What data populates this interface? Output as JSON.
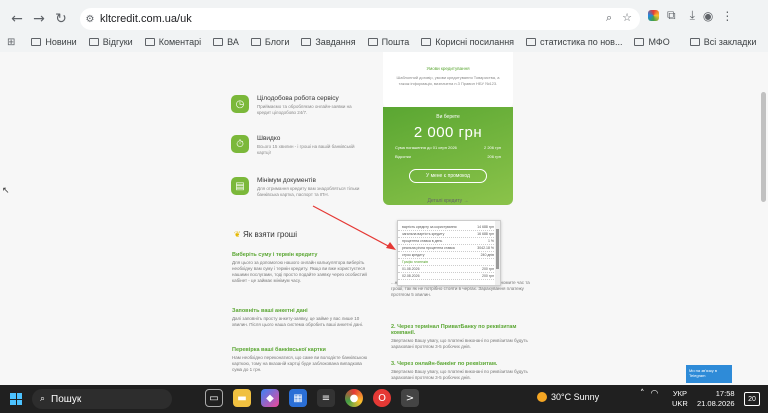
{
  "browser": {
    "url": "kltcredit.com.ua/uk",
    "bookmarks": [
      "Новини",
      "Відгуки",
      "Коментарі",
      "ВА",
      "Блоги",
      "Завдання",
      "Пошта",
      "Корисні посилання",
      "статистика по нов...",
      "МФО"
    ],
    "all_bookmarks": "Всі закладки"
  },
  "features": [
    {
      "title": "Цілодобова робота сервісу",
      "text": "Приймаємо та обробляємо онлайн-заявки на кредит цілодобово 24/7.",
      "icon": "clock-24-icon"
    },
    {
      "title": "Швидко",
      "text": "Всього 15 хвилин - і гроші на вашій банківській картці!",
      "icon": "stopwatch-icon"
    },
    {
      "title": "Мінімум документів",
      "text": "Для отримання кредиту вам знадобляться тільки банківська картка, паспорт та ІПН.",
      "icon": "document-icon"
    }
  ],
  "card": {
    "top_link": "Умови кредитування",
    "top_text": "Шаблонний договір, умови кредитування Товариства, а також інформація, визначена п.3 Правил НБУ №123.",
    "label": "Ви берете",
    "amount": "2 000 грн",
    "rows": [
      {
        "k": "Сума погашення до 01 серп 2026",
        "v": "2 206 грн"
      },
      {
        "k": "Відсотки",
        "v": "206 грн"
      }
    ],
    "button": "У мене є промокод",
    "details": "Деталі кредиту →"
  },
  "howto": {
    "title": "Як взяти гроші",
    "left": [
      {
        "h": "Виберіть суму і термін кредиту",
        "t": "Для цього за допомогою нашого онлайн калькулятора виберіть необхідну вам суму і термін кредиту. Якщо ви вже користуєтеся нашими послугами, тоді просто подайте заявку через особистий кабінет - це займає мінімум часу."
      },
      {
        "h": "Заповніть ваші анкетні дані",
        "t": "Далі заповніть просту анкету-заявку, це займе у вас лише 10 хвилин. Після цього наша система обробить ваші анкетні дані."
      },
      {
        "h": "Перевірка ваші банківської картки",
        "t": "Нам необхідно переконатися, що саме ви володієте банківською карткою, тому на вказаній картці буде заблокована випадкова сума до 1 грн."
      }
    ],
    "right": [
      {
        "h": "1. ...",
        "t": "...найзручніший спосіб оплати, завдяки якому ви економите час та гроші, так як не потрібно стояти в чергах. Зарахування платежу протягом 5 хвилин."
      },
      {
        "h": "2. Через термінал ПриватБанку по реквізитам компанії.",
        "t": "Звертаємо Вашу увагу, що платежі виконані по реквізитам будуть зараховані протягом 3-5 робочих днів."
      },
      {
        "h": "3. Через онлайн-банкінг по реквізитам.",
        "t": "Звертаємо Вашу увагу, що платежі виконані по реквізитам будуть зараховані протягом 3-5 робочих днів."
      }
    ]
  },
  "popup_rows": [
    {
      "k": "вартість кредиту за користування",
      "v": "14 688 грн"
    },
    {
      "k": "загальна вартість кредиту",
      "v": "16 688 грн"
    },
    {
      "k": "процентна ставка в день",
      "v": "1 %"
    },
    {
      "k": "реальна річна процентна ставка",
      "v": "3042.18 %"
    },
    {
      "k": "строк кредиту",
      "v": "240 днів"
    },
    {
      "k": "Графік платежів",
      "v": ""
    },
    {
      "k": "01.08.2026",
      "v": "200 грн"
    },
    {
      "k": "02.08.2026",
      "v": "200 грн"
    }
  ],
  "chat": "Ми на зв'язку в Telegram",
  "taskbar": {
    "search": "Пошук",
    "weather": "30°C Sunny",
    "lang1": "УКР",
    "lang2": "UKR",
    "time": "17:58",
    "date": "21.08.2026",
    "notif": "20"
  }
}
